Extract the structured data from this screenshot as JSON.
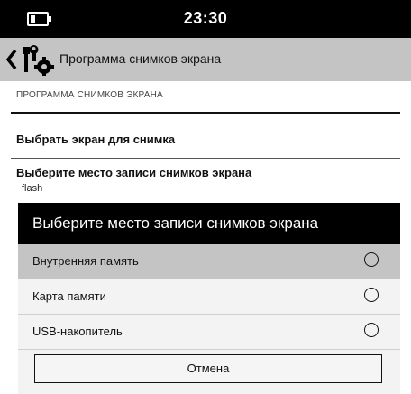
{
  "status_bar": {
    "time": "23:30",
    "battery_icon": "battery-icon"
  },
  "toolbar": {
    "title": "Программа снимков экрана",
    "back_icon": "chevron-left-icon",
    "app_icon": "tools-gear-icon"
  },
  "settings": {
    "section_header": "ПРОГРАММА СНИМКОВ ЭКРАНА",
    "items": [
      {
        "title": "Выбрать экран для снимка"
      },
      {
        "title": "Выберите место записи снимков экрана",
        "summary": "flash"
      }
    ]
  },
  "dialog": {
    "title": "Выберите место записи снимков экрана",
    "options": [
      {
        "label": "Внутренняя память",
        "selected": true
      },
      {
        "label": "Карта памяти",
        "selected": false
      },
      {
        "label": "USB-накопитель",
        "selected": false
      }
    ],
    "cancel_label": "Отмена"
  },
  "colors": {
    "status_bar_bg": "#000000",
    "toolbar_bg": "#c4c4c4",
    "highlight": "#c4c4c4",
    "dialog_bg": "#f3f3f3"
  }
}
